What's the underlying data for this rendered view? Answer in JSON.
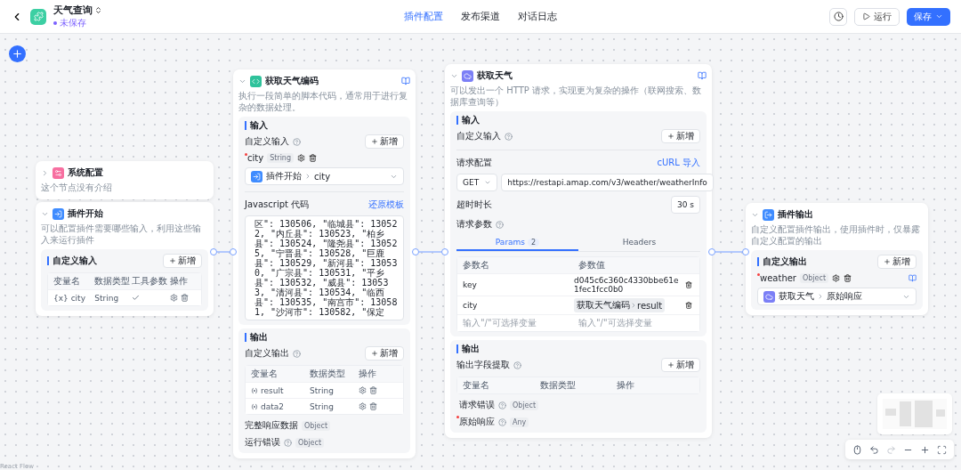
{
  "header": {
    "title": "天气查询",
    "status": "未保存",
    "tabs": [
      {
        "label": "插件配置",
        "selected": true
      },
      {
        "label": "发布渠道",
        "selected": false
      },
      {
        "label": "对话日志",
        "selected": false
      }
    ],
    "run_button": "运行",
    "save_button": "保存"
  },
  "system_node": {
    "title": "系统配置",
    "description": "这个节点没有介绍",
    "expanded": false
  },
  "start_node": {
    "title": "插件开始",
    "description": "可以配置插件需要哪些输入，利用这些输入来运行插件",
    "expanded": true,
    "section": "自定义输入",
    "add_button": "新增",
    "columns": [
      "变量名",
      "数据类型",
      "工具参数",
      "操作"
    ],
    "rows": [
      {
        "icon": "{x}",
        "name": "city",
        "type": "String",
        "tool_param": true
      }
    ]
  },
  "code_node": {
    "title": "获取天气编码",
    "description": "执行一段简单的脚本代码，通常用于进行复杂的数据处理。",
    "expanded": true,
    "input_title": "输入",
    "custom_input": "自定义输入",
    "add_button": "新增",
    "param": {
      "name": "city",
      "required": true,
      "type": "String",
      "source_node": "插件开始",
      "source_field": "city"
    },
    "code_label": "Javascript 代码",
    "code_link": "还原模板",
    "code": "区\": 130506, \"临城县\": 130522, \"内丘县\": 130523, \"柏乡县\": 130524, \"隆尧县\": 130525, \"宁晋县\": 130528, \"巨鹿县\": 130529, \"新河县\": 130530, \"广宗县\": 130531, \"平乡县\": 130532, \"威县\": 130533, \"清河县\": 130534, \"临西县\": 130535, \"南宫市\": 130581, \"沙河市\": 130582, \"保定",
    "output_title": "输出",
    "custom_output": "自定义输出",
    "output_add_button": "新增",
    "columns": [
      "变量名",
      "数据类型",
      "操作"
    ],
    "outputs": [
      {
        "name": "result",
        "type": "String"
      },
      {
        "name": "data2",
        "type": "String"
      }
    ],
    "fixed_outputs": [
      {
        "label": "完整响应数据",
        "type": "Object",
        "help": false
      },
      {
        "label": "运行错误",
        "type": "Object",
        "help": true
      }
    ]
  },
  "http_node": {
    "title": "获取天气",
    "description": "可以发出一个 HTTP 请求，实现更为复杂的操作（联网搜索、数据库查询等）",
    "expanded": true,
    "input_title": "输入",
    "custom_input": "自定义输入",
    "add_button": "新增",
    "request_config": "请求配置",
    "curl_link": "cURL 导入",
    "method": "GET",
    "url": "https://restapi.amap.com/v3/weather/weatherInfo",
    "timeout_label": "超时时长",
    "timeout": "30 s",
    "params_label": "请求参数",
    "tabs": [
      {
        "label": "Params",
        "count": "2",
        "selected": true
      },
      {
        "label": "Headers",
        "selected": false
      }
    ],
    "param_columns": [
      "参数名",
      "参数值"
    ],
    "params": [
      {
        "kind": "text",
        "name": "key",
        "value": "d045c6c360c4330bbe61e1fec1fcc0b0"
      },
      {
        "kind": "reference",
        "name": "city",
        "ref_node": "获取天气编码",
        "ref_field": "result"
      }
    ],
    "param_placeholders": [
      "输入\"/\"可选择变量",
      "输入\"/\"可选择变量"
    ],
    "output_title": "输出",
    "extract_label": "输出字段提取",
    "output_add_button": "新增",
    "output_columns": [
      "变量名",
      "数据类型",
      "操作"
    ],
    "fixed_outputs": [
      {
        "label": "请求错误",
        "type": "Object",
        "required": false
      },
      {
        "label": "原始响应",
        "type": "Any",
        "required": true
      }
    ]
  },
  "end_node": {
    "title": "插件输出",
    "description": "自定义配置插件输出，使用插件时，仅暴露自定义配置的输出",
    "expanded": true,
    "section": "自定义输出",
    "add_button": "新增",
    "output": {
      "name": "weather",
      "required": true,
      "type": "Object",
      "source_node": "获取天气",
      "source_field": "原始响应"
    }
  },
  "footer": {
    "attribution": "React Flow"
  }
}
